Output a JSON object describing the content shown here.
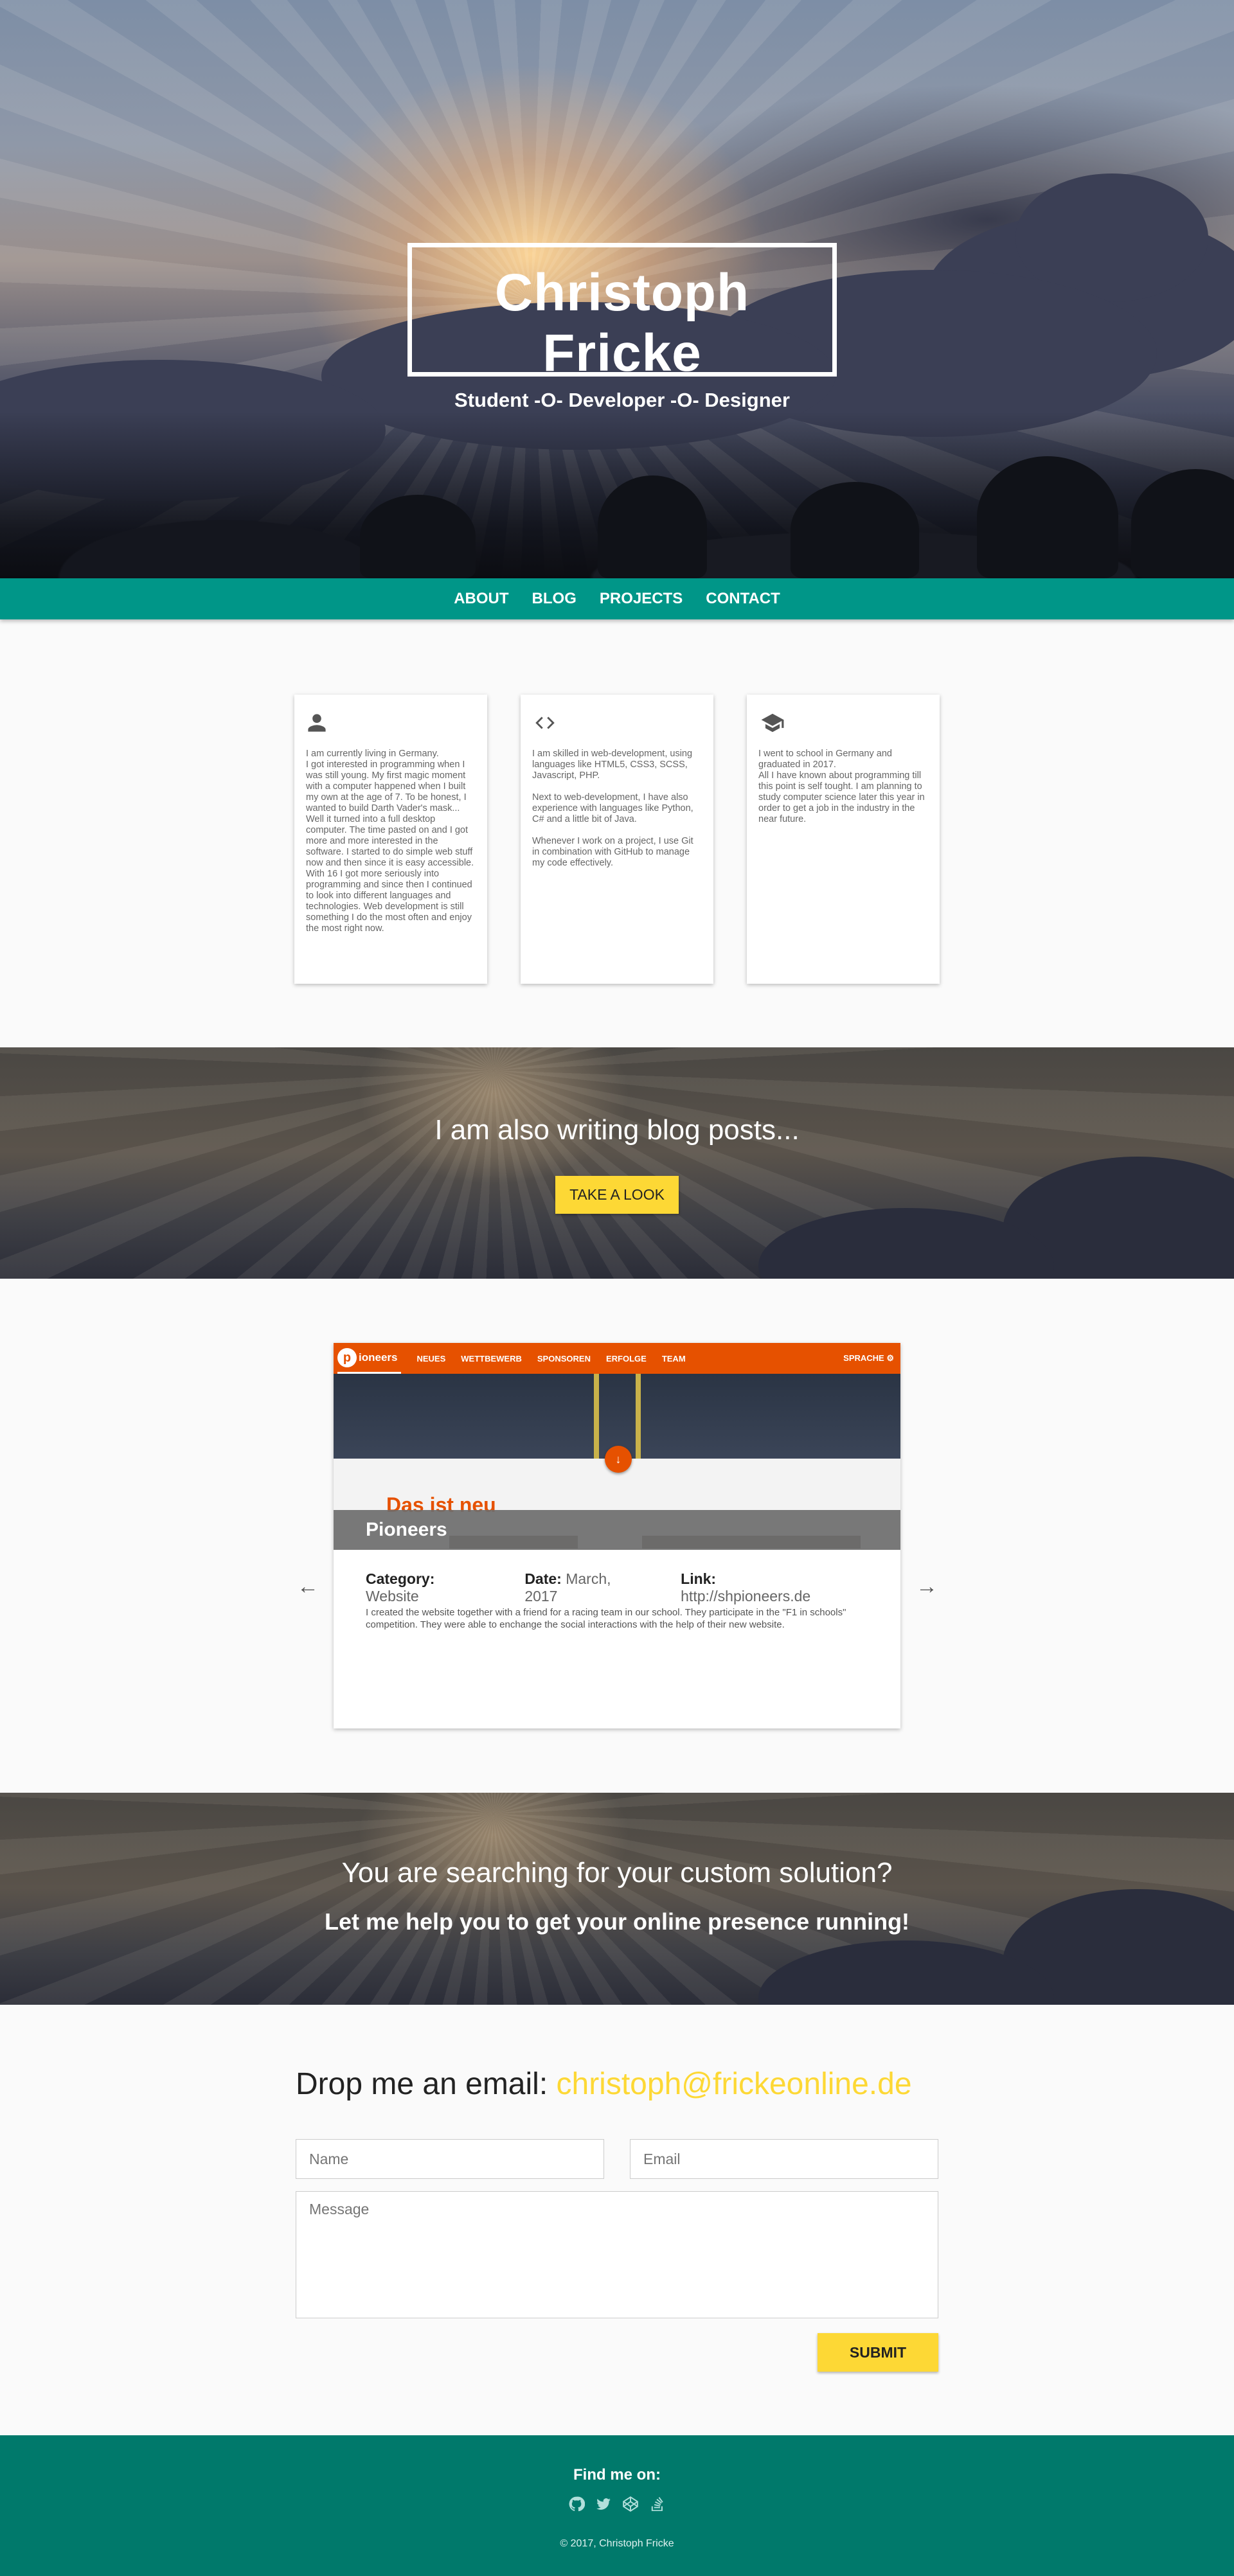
{
  "hero": {
    "title": "Christoph Fricke",
    "subtitle": "Student -O- Developer -O- Designer"
  },
  "nav": {
    "items": [
      "ABOUT",
      "BLOG",
      "PROJECTS",
      "CONTACT"
    ]
  },
  "about": {
    "cards": [
      {
        "icon": "person-icon",
        "text": "I am currently living in Germany.\nI got interested in programming when I was still young. My first magic moment with a computer happened when I built my own at the age of 7. To be honest, I wanted to build Darth Vader's mask... Well it turned into a full desktop computer. The time pasted on and I got more and more interested in the software. I started to do simple web stuff now and then since it is easy accessible. With 16 I got more seriously into programming and since then I continued to look into different languages and technologies. Web development is still something I do the most often and enjoy the most right now."
      },
      {
        "icon": "code-icon",
        "text": "I am skilled in web-development, using languages like HTML5, CSS3, SCSS, Javascript, PHP.\n\nNext to web-development, I have also experience with languages like Python, C# and a little bit of Java.\n\nWhenever I work on a project, I use Git in combination with GitHub to manage my code effectively."
      },
      {
        "icon": "graduation-cap-icon",
        "text": "I went to school in Germany and graduated in 2017.\nAll I have known about programming till this point is self tought. I am planning to study computer science later this year in order to get a job in the industry in the near future."
      }
    ]
  },
  "blog_banner": {
    "heading": "I am also writing blog posts...",
    "button": "TAKE A LOOK"
  },
  "project": {
    "screenshot": {
      "logo_letter": "p",
      "logo_text": "ioneers",
      "nav_items": [
        "NEUES",
        "WETTBEWERB",
        "SPONSOREN",
        "ERFOLGE",
        "TEAM"
      ],
      "lang": "SPRACHE ⚙",
      "heading": "Das ist neu",
      "fab": "↓"
    },
    "title": "Pioneers",
    "category_label": "Category:",
    "category": "Website",
    "date_label": "Date:",
    "date": "March, 2017",
    "link_label": "Link:",
    "link": "http://shpioneers.de",
    "description": "I created the website together with a friend for a racing team in our school. They participate in the \"F1 in schools\" competition. They were able to enchange the social interactions with the help of their new website.",
    "prev_arrow": "←",
    "next_arrow": "→"
  },
  "solution_banner": {
    "heading": "You are searching for your custom solution?",
    "subheading": "Let me help you to get your online presence running!"
  },
  "contact": {
    "heading": "Drop me an email: ",
    "email": "christoph@frickeonline.de",
    "name_placeholder": "Name",
    "email_placeholder": "Email",
    "message_placeholder": "Message",
    "submit": "SUBMIT"
  },
  "footer": {
    "find_me": "Find me on:",
    "socials": [
      "github-icon",
      "twitter-icon",
      "codepen-icon",
      "stackoverflow-icon"
    ],
    "copyright": "© 2017, Christoph Fricke"
  },
  "colors": {
    "primary": "#009688",
    "footer": "#00796b",
    "accent": "#fdd835",
    "project_orange": "#e65100"
  }
}
